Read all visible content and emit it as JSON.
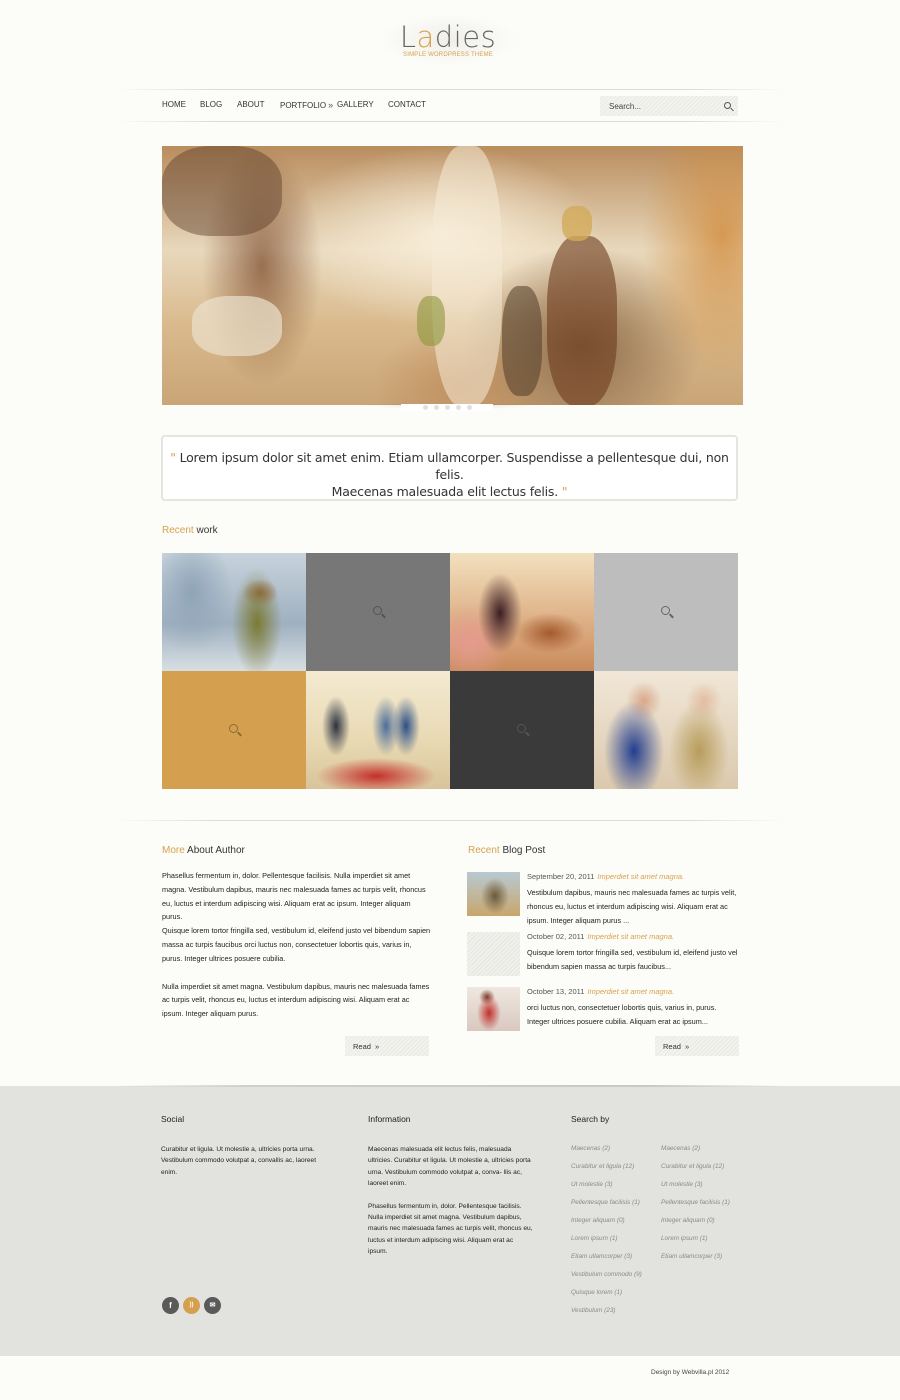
{
  "logo": {
    "word_prefix": "L",
    "word_accent": "a",
    "word_suffix": "dies",
    "tagline": "SIMPLE WORDPRESS THEME"
  },
  "nav": {
    "items": [
      {
        "label": "HOME"
      },
      {
        "label": "BLOG"
      },
      {
        "label": "ABOUT"
      },
      {
        "label": "PORTFOLIO",
        "submenu_indicator": "»"
      },
      {
        "label": "GALLERY"
      },
      {
        "label": "CONTACT"
      }
    ],
    "search_placeholder": "Search..."
  },
  "hero": {
    "slide_count": 5,
    "active_slide": 1
  },
  "quote": {
    "open_mark": "\"",
    "line1": "Lorem ipsum dolor sit amet enim. Etiam ullamcorper. Suspendisse a pellentesque dui, non felis.",
    "line2": "Maecenas malesuada elit lectus felis.",
    "close_mark": "\""
  },
  "recent_work": {
    "title_accent": "Recent",
    "title_rest": " work",
    "tiles": [
      {
        "kind": "image",
        "subject": "woman with coffee in street"
      },
      {
        "kind": "overlay",
        "color": "#777777"
      },
      {
        "kind": "image",
        "subject": "vintage interior"
      },
      {
        "kind": "overlay",
        "color": "#bdbdbd"
      },
      {
        "kind": "overlay",
        "color": "#d4a04f"
      },
      {
        "kind": "image",
        "subject": "people near red car"
      },
      {
        "kind": "overlay",
        "color": "#3a3a3a"
      },
      {
        "kind": "image",
        "subject": "two elderly women"
      }
    ]
  },
  "author": {
    "title_accent": "More",
    "title_rest": " About Author",
    "para1": "Phasellus fermentum in, dolor. Pellentesque facilisis. Nulla imperdiet sit amet magna. Vestibulum dapibus, mauris nec malesuada fames ac turpis velit, rhoncus eu, luctus et interdum adipiscing wisi. Aliquam erat ac ipsum. Integer aliquam purus.",
    "para2": "Quisque lorem tortor fringilla sed, vestibulum id, eleifend justo vel bibendum sapien massa ac turpis faucibus orci luctus non, consectetuer lobortis quis, varius in, purus. Integer ultrices posuere cubilia.",
    "para3": "Nulla imperdiet sit amet magna. Vestibulum dapibus, mauris nec malesuada fames ac turpis velit, rhoncus eu, luctus et interdum adipiscing wisi. Aliquam erat ac ipsum. Integer aliquam purus.",
    "read_label": "Read",
    "read_chevron": "»"
  },
  "blog": {
    "title_accent": "Recent",
    "title_rest": " Blog Post",
    "posts": [
      {
        "date": "September 20, 2011",
        "title": "Imperdiet sit amet magna.",
        "excerpt": "Vestibulum dapibus, mauris nec malesuada fames ac turpis velit, rhoncus eu, luctus et interdum adipiscing wisi. Aliquam erat ac ipsum. Integer aliquam purus ..."
      },
      {
        "date": "October 02, 2011",
        "title": "Imperdiet sit amet magna.",
        "excerpt": "Quisque lorem tortor fringilla sed, vestibulum id, eleifend justo vel bibendum sapien massa ac turpis faucibus..."
      },
      {
        "date": "October 13, 2011",
        "title": "Imperdiet sit amet magna.",
        "excerpt": " orci luctus non, consectetuer lobortis quis, varius in, purus. Integer ultrices posuere cubilia. Aliquam erat ac ipsum..."
      }
    ],
    "read_label": "Read",
    "read_chevron": "»"
  },
  "footer": {
    "social": {
      "title": "Social",
      "text": "Curabitur et ligula. Ut molestie a, ultricies porta urna. Vestibulum commodo volutpat a, convallis ac, laoreet enim.",
      "icons": [
        {
          "name": "facebook-icon",
          "glyph": "f",
          "color": "#5a5a5a"
        },
        {
          "name": "rss-icon",
          "glyph": "))",
          "color": "#d4a04f"
        },
        {
          "name": "email-icon",
          "glyph": "✉",
          "color": "#5a5a5a"
        }
      ]
    },
    "information": {
      "title": "Information",
      "para1": " Maecenas malesuada elit lectus felis, malesuada ultricies. Curabitur et ligula. Ut molestie a, ultricies porta urna. Vestibulum commodo volutpat a, conva- llis ac, laoreet enim.",
      "para2": "Phasellus fermentum in, dolor. Pellentesque facilisis. Nulla imperdiet sit amet magna. Vestibulum dapibus, mauris nec malesuada fames ac turpis velit, rhoncus eu, luctus et interdum adipiscing wisi. Aliquam erat ac ipsum."
    },
    "search_by": {
      "title": "Search by",
      "col1": [
        "Maecenas (2)",
        "Curabitur et ligula (12)",
        "Ut molestie (3)",
        "Pellentesque facilisis (1)",
        "Integer aliquam (0)",
        "Lorem ipsum (1)",
        "Etiam ullamcorper (3)",
        "Vestibulum commodo (9)",
        "Quisque lorem (1)",
        "Vestibulum (23)"
      ],
      "col2": [
        "Maecenas (2)",
        "Curabitur et ligula (12)",
        "Ut molestie (3)",
        "Pellentesque facilisis (1)",
        "Integer aliquam (0)",
        "Lorem ipsum (1)",
        "Etiam ullamcorper (3)"
      ]
    },
    "credit": "Design by Webvilla.pl 2012"
  },
  "colors": {
    "accent": "#d7a24d",
    "background": "#fcfcf8",
    "footer_bg": "#e2e2df"
  }
}
